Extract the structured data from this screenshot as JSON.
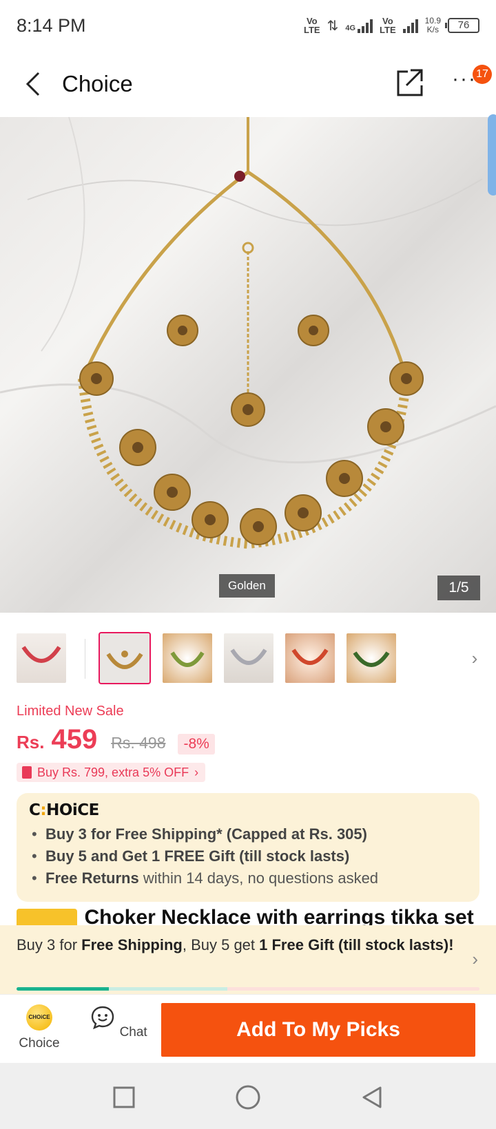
{
  "status_bar": {
    "time": "8:14 PM",
    "sim1_label": "Vo\nLTE",
    "network_label": "4G",
    "sim2_label": "Vo\nLTE",
    "net_speed": "10.9\nK/s",
    "battery": "76"
  },
  "header": {
    "title": "Choice",
    "cart_badge": "17"
  },
  "gallery": {
    "variant_label": "Golden",
    "counter": "1/5",
    "thumbnail_count": 6,
    "selected_thumbnail": 1
  },
  "price": {
    "sale_tag": "Limited New Sale",
    "currency": "Rs.",
    "current": "459",
    "original": "Rs. 498",
    "discount": "-8%",
    "promo": "Buy Rs. 799, extra 5% OFF"
  },
  "choice_card": {
    "logo": "CHOiCE",
    "benefits": [
      {
        "bold": "Buy 3 for  Free Shipping* (Capped at Rs. 305)",
        "rest": ""
      },
      {
        "bold": "Buy 5 and Get 1 FREE Gift (till stock lasts)",
        "rest": ""
      },
      {
        "bold": "Free Returns",
        "rest": " within 14 days, no questions asked"
      }
    ]
  },
  "product": {
    "title": "Choker Necklace with earrings tikka set"
  },
  "shipping_banner": {
    "part1": "Buy 3 for ",
    "bold1": "Free Shipping",
    "part2": ", Buy 5 get ",
    "bold2": "1 Free Gift (till stock lasts)!",
    "progress": 0.2
  },
  "action_bar": {
    "choice_label": "Choice",
    "choice_icon_text": "CHOiCE",
    "chat_label": "Chat",
    "add_button": "Add To My Picks"
  },
  "colors": {
    "accent": "#f5520f",
    "price": "#ec3d56",
    "choice_bg": "#fcf2d8",
    "progress": "#19b38f"
  },
  "icons": {
    "back": "chevron-left-icon",
    "share": "share-icon",
    "more": "more-icon",
    "chat": "chat-icon",
    "nav_recent": "square-icon",
    "nav_home": "circle-icon",
    "nav_back": "triangle-back-icon"
  }
}
